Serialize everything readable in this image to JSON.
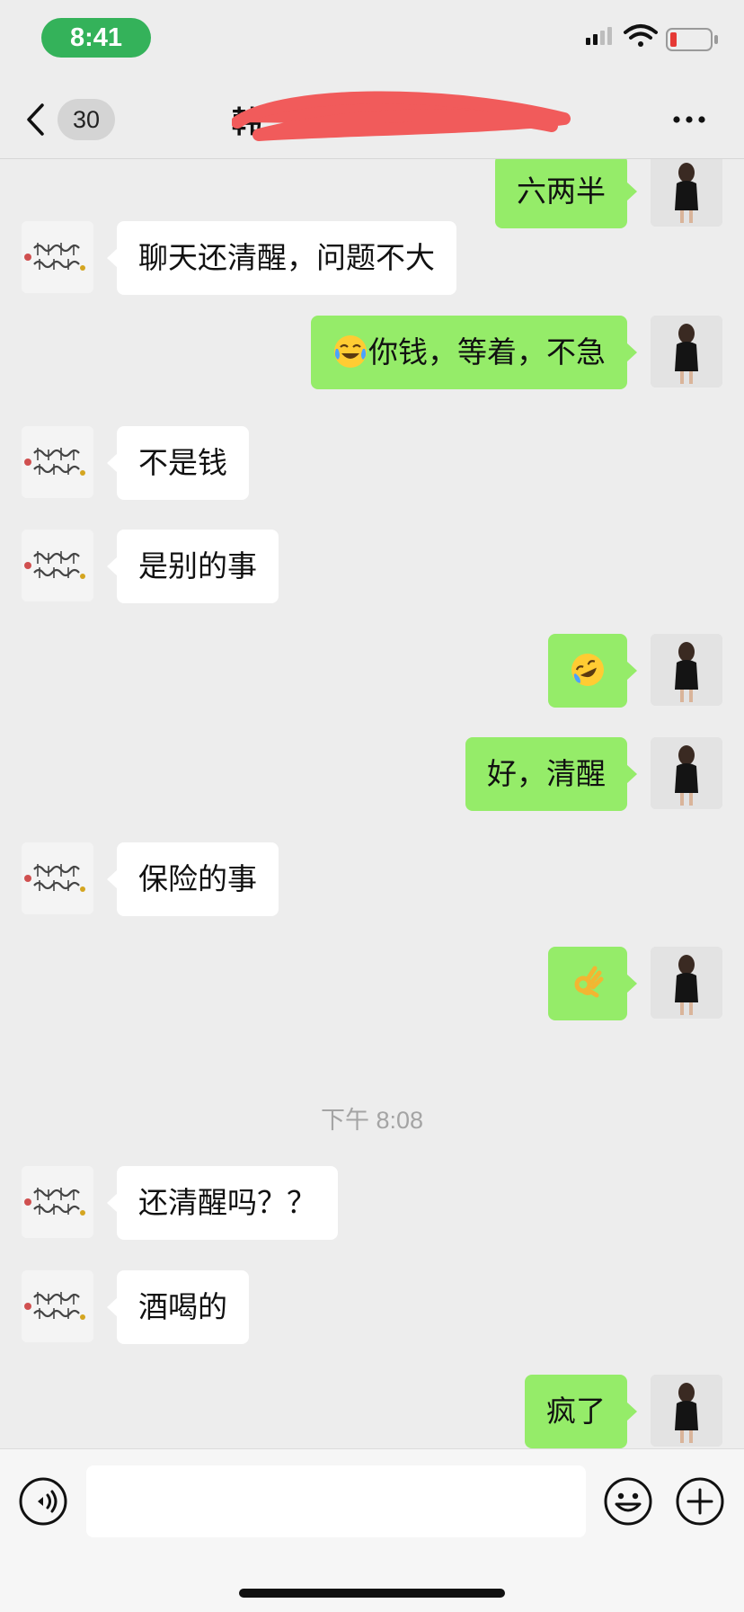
{
  "status_bar": {
    "time": "8:41",
    "icons": [
      "signal-icon",
      "wifi-icon",
      "battery-low-icon"
    ]
  },
  "nav": {
    "unread_count": "30",
    "title": "韩"
  },
  "messages": [
    {
      "side": "out",
      "text": "六两半"
    },
    {
      "side": "in",
      "text": "聊天还清醒，问题不大"
    },
    {
      "side": "out",
      "text": "你钱，等着，不急",
      "emoji": "tears-of-joy-emoji"
    },
    {
      "side": "in",
      "text": "不是钱"
    },
    {
      "side": "in",
      "text": "是别的事"
    },
    {
      "side": "out",
      "text": "",
      "emoji": "rolling-laughing-emoji"
    },
    {
      "side": "out",
      "text": "好，清醒"
    },
    {
      "side": "in",
      "text": "保险的事"
    },
    {
      "side": "out",
      "text": "",
      "emoji": "ok-hand-emoji"
    },
    {
      "timestamp": "下午 8:08"
    },
    {
      "side": "in",
      "text": "还清醒吗？？"
    },
    {
      "side": "in",
      "text": "酒喝的"
    },
    {
      "side": "out",
      "text": "疯了"
    }
  ],
  "input": {
    "value": "",
    "placeholder": ""
  },
  "colors": {
    "outgoing_bubble": "#95ec69",
    "incoming_bubble": "#ffffff",
    "background": "#ededed",
    "time_pill": "#34b25a"
  }
}
